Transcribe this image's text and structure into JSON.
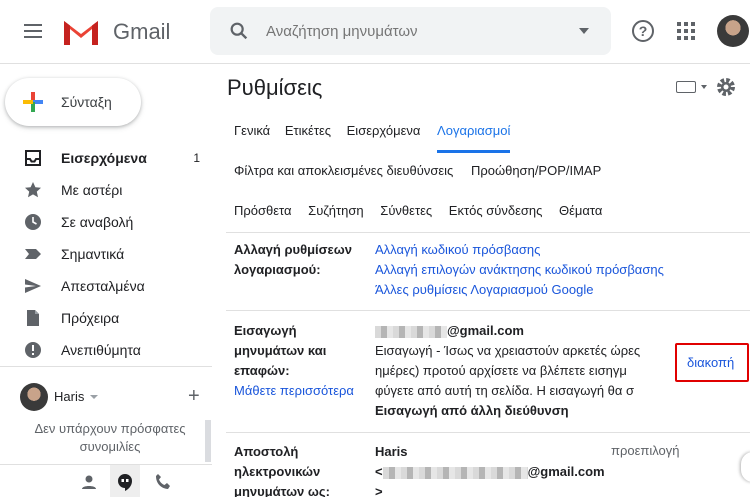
{
  "header": {
    "app_name": "Gmail",
    "search_placeholder": "Αναζήτηση μηνυμάτων",
    "help_glyph": "?"
  },
  "sidebar": {
    "compose_label": "Σύνταξη",
    "items": [
      {
        "label": "Εισερχόμενα",
        "count": "1",
        "icon": "inbox-icon",
        "active": true
      },
      {
        "label": "Με αστέρι",
        "count": "",
        "icon": "star-icon"
      },
      {
        "label": "Σε αναβολή",
        "count": "",
        "icon": "clock-icon"
      },
      {
        "label": "Σημαντικά",
        "count": "",
        "icon": "important-icon"
      },
      {
        "label": "Απεσταλμένα",
        "count": "",
        "icon": "send-icon"
      },
      {
        "label": "Πρόχειρα",
        "count": "",
        "icon": "draft-icon"
      },
      {
        "label": "Ανεπιθύμητα",
        "count": "",
        "icon": "spam-icon"
      }
    ],
    "hangouts": {
      "user_name": "Haris",
      "add_glyph": "+",
      "empty_message": "Δεν υπάρχουν πρόσφατες συνομιλίες"
    }
  },
  "main": {
    "title": "Ρυθμίσεις",
    "tabs_row1": [
      "Γενικά",
      "Ετικέτες",
      "Εισερχόμενα",
      "Λογαριασμοί"
    ],
    "active_tab": "Λογαριασμοί",
    "tabs_row2": [
      "Φίλτρα και αποκλεισμένες διευθύνσεις",
      "Προώθηση/POP/IMAP"
    ],
    "tabs_row3": [
      "Πρόσθετα",
      "Συζήτηση",
      "Σύνθετες",
      "Εκτός σύνδεσης",
      "Θέματα"
    ],
    "account_settings": {
      "label_line1": "Αλλαγή ρυθμίσεων",
      "label_line2": "λογαριασμού:",
      "links": [
        "Αλλαγή κωδικού πρόσβασης",
        "Αλλαγή επιλογών ανάκτησης κωδικού πρόσβασης",
        "Άλλες ρυθμίσεις Λογαριασμού Google"
      ]
    },
    "import": {
      "label_line1": "Εισαγωγή",
      "label_line2": "μηνυμάτων και",
      "label_line3": "επαφών:",
      "learn_more": "Μάθετε περισσότερα",
      "email_suffix": "@gmail.com",
      "status_line1": "Εισαγωγή - Ίσως να χρειαστούν αρκετές ώρες",
      "status_line2": "ημέρες) προτού αρχίσετε να βλέπετε εισηγμ",
      "status_line3": "φύγετε από αυτή τη σελίδα. Η εισαγωγή θα σ",
      "stop_link": "διακοπή",
      "import_other": "Εισαγωγή από άλλη διεύθυνση"
    },
    "send_as": {
      "label_line1": "Αποστολή",
      "label_line2": "ηλεκτρονικών",
      "label_line3": "μηνυμάτων ως:",
      "name": "Haris",
      "email_prefix": "<",
      "email_suffix": "@gmail.com",
      "line3": ">",
      "default_label": "προεπιλογή"
    }
  },
  "colors": {
    "link": "#1a56db",
    "accent": "#1a73e8",
    "highlight_box": "#e00000"
  }
}
